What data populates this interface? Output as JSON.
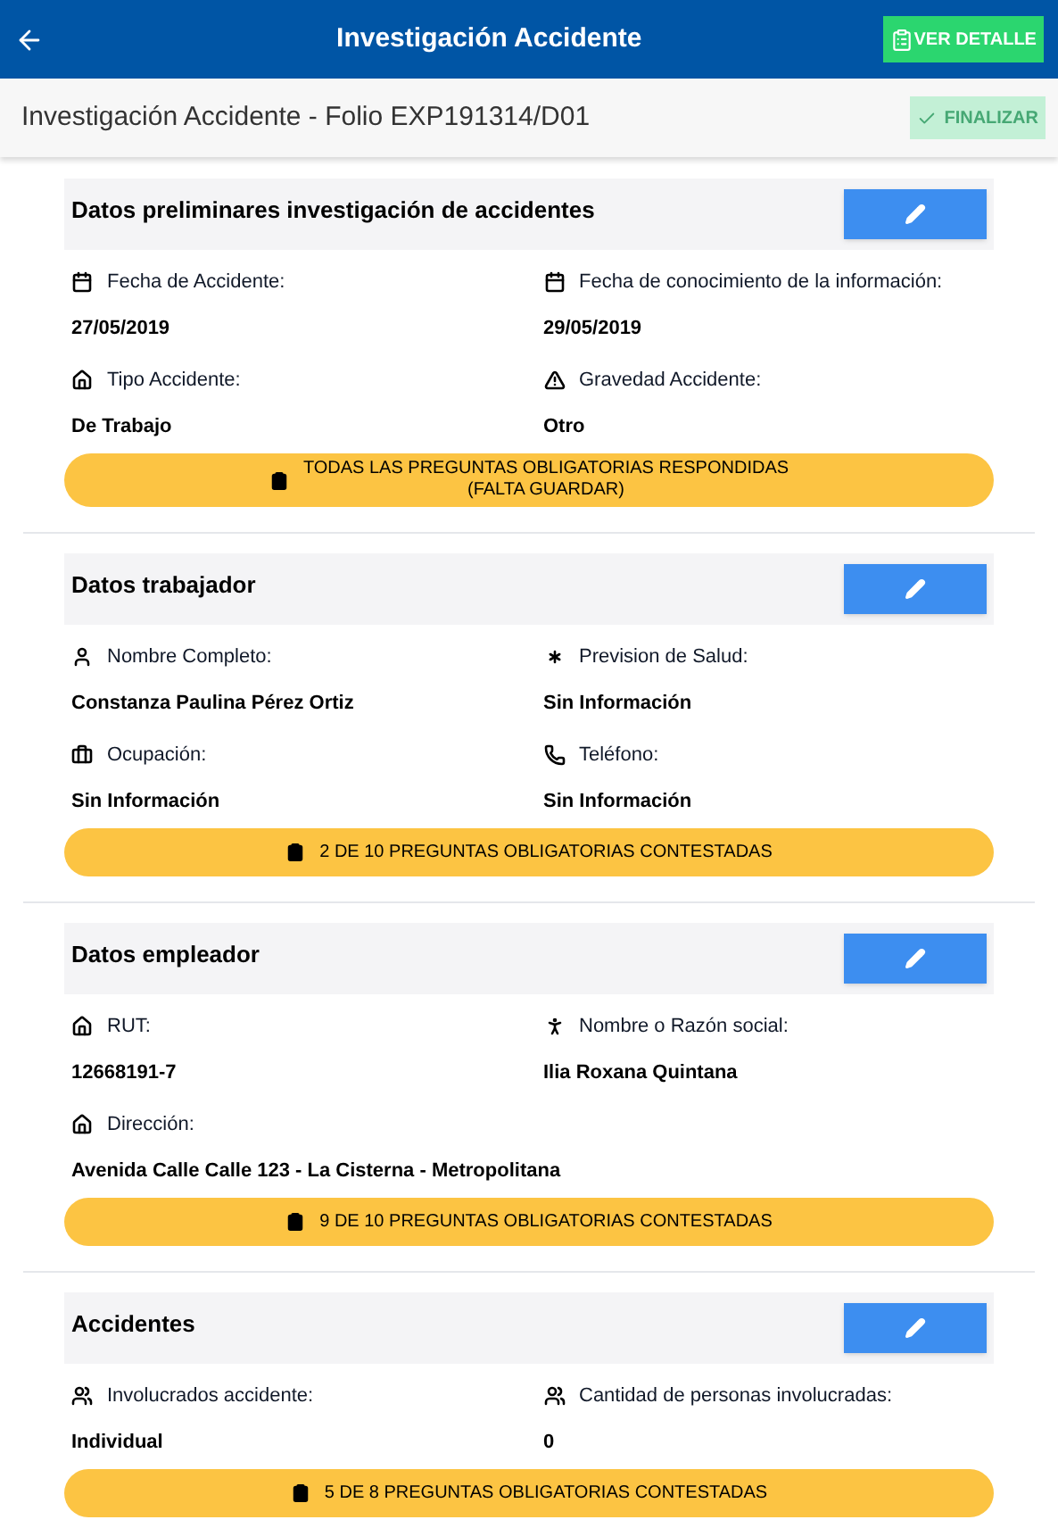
{
  "app_bar": {
    "title": "Investigación Accidente",
    "detail_button": "VER DETALLE"
  },
  "subheader": {
    "title": "Investigación Accidente - Folio EXP191314/D01",
    "finish_button": {
      "label": "FINALIZAR",
      "disabled": true
    }
  },
  "sections": [
    {
      "title": "Datos preliminares investigación de accidentes",
      "fields": [
        {
          "kind": "date",
          "label": "Fecha de Accidente:",
          "value": "27/05/2019"
        },
        {
          "kind": "date",
          "label": "Fecha de conocimiento de la información:",
          "value": "29/05/2019"
        },
        {
          "kind": "home",
          "label": "Tipo Accidente:",
          "value": "De Trabajo"
        },
        {
          "kind": "warning",
          "label": "Gravedad Accidente:",
          "value": "Otro"
        }
      ],
      "status": [
        "TODAS LAS PREGUNTAS OBLIGATORIAS RESPONDIDAS",
        "(FALTA GUARDAR)"
      ]
    },
    {
      "title": "Datos trabajador",
      "fields": [
        {
          "kind": "user",
          "label": "Nombre Completo:",
          "value": "Constanza Paulina Pérez Ortiz"
        },
        {
          "kind": "asterisk",
          "label": "Prevision de Salud:",
          "value": "Sin Información"
        },
        {
          "kind": "briefcase",
          "label": "Ocupación:",
          "value": "Sin Información"
        },
        {
          "kind": "phone",
          "label": "Teléfono:",
          "value": "Sin Información"
        }
      ],
      "status": [
        "2 DE 10 PREGUNTAS OBLIGATORIAS CONTESTADAS"
      ]
    },
    {
      "title": "Datos empleador",
      "fields": [
        {
          "kind": "home",
          "label": "RUT:",
          "value": "12668191-7"
        },
        {
          "kind": "person",
          "label": "Nombre o Razón social:",
          "value": "Ilia Roxana Quintana"
        },
        {
          "kind": "home",
          "label": "Dirección:",
          "value": "Avenida Calle Calle 123 - La Cisterna - Metropolitana"
        }
      ],
      "status": [
        "9 DE 10 PREGUNTAS OBLIGATORIAS CONTESTADAS"
      ]
    },
    {
      "title": "Accidentes",
      "fields": [
        {
          "kind": "group",
          "label": "Involucrados accidente:",
          "value": "Individual"
        },
        {
          "kind": "group",
          "label": "Cantidad de personas involucradas:",
          "value": "0"
        }
      ],
      "status": [
        "5 DE 8 PREGUNTAS OBLIGATORIAS CONTESTADAS"
      ]
    }
  ]
}
